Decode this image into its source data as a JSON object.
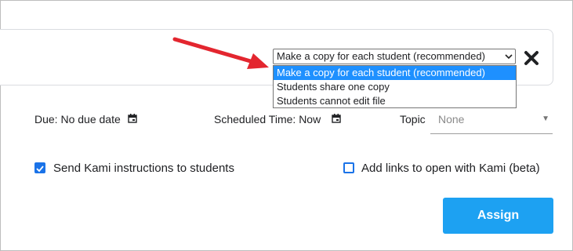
{
  "sharing": {
    "selected": "Make a copy for each student (recommended)",
    "options": [
      "Make a copy for each student (recommended)",
      "Students share one copy",
      "Students cannot edit file"
    ]
  },
  "due": {
    "label": "Due:",
    "value": "No due date"
  },
  "scheduled": {
    "label": "Scheduled Time:",
    "value": "Now"
  },
  "topic": {
    "label": "Topic",
    "value": "None"
  },
  "checks": {
    "send_instructions": {
      "label": "Send Kami instructions to students",
      "checked": true
    },
    "add_links": {
      "label": "Add links to open with Kami (beta)",
      "checked": false
    }
  },
  "assign_label": "Assign",
  "colors": {
    "accent": "#1a73e8",
    "button": "#1da1f2",
    "arrow": "#e3262f",
    "highlight": "#1e90ff"
  }
}
